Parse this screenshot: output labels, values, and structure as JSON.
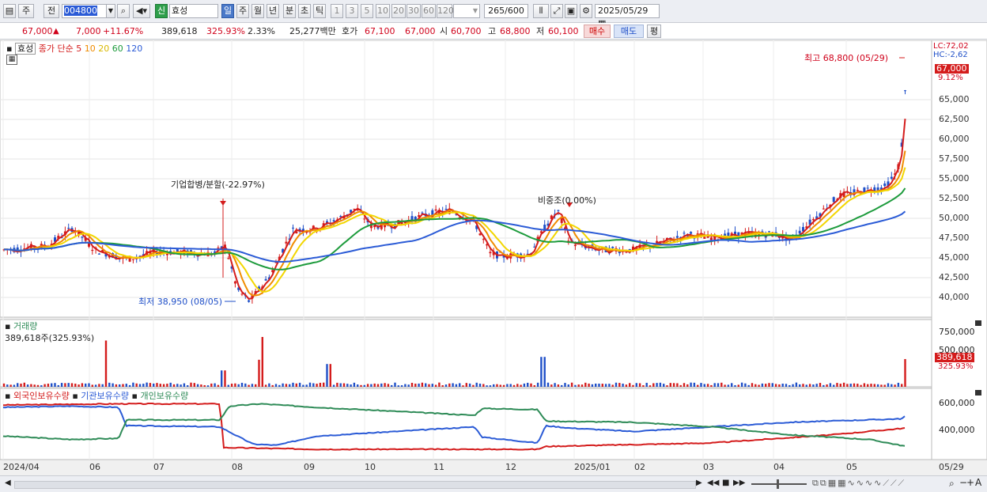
{
  "toolbar": {
    "period": "주",
    "prev": "전",
    "code": "004800",
    "credit": "신",
    "name": "효성",
    "intervals": [
      "일",
      "주",
      "월",
      "년",
      "분",
      "초",
      "틱"
    ],
    "active_interval": "일",
    "minutes": [
      "1",
      "3",
      "5",
      "10",
      "20",
      "30",
      "60",
      "120"
    ],
    "count": "265",
    "count_total": "/600",
    "date": "2025/05/29"
  },
  "quote": {
    "price": "67,000",
    "up_arrow": "▲",
    "change": "7,000",
    "change_pct": "+11.67%",
    "volume": "389,618",
    "volume_ratio": "325.93%",
    "turnover": "2.33%",
    "amount": "25,277백만",
    "ask_label": "호가",
    "ask": "67,100",
    "bid": "67,000",
    "open_label": "시",
    "open": "60,700",
    "high_label": "고",
    "high": "68,800",
    "low_label": "저",
    "low": "60,100",
    "buy": "매수",
    "sell": "매도",
    "eval": "평"
  },
  "legend": {
    "name": "효성",
    "ma_label": "종가 단순",
    "ma_periods": [
      "5",
      "10",
      "20",
      "60",
      "120"
    ],
    "ma_colors": [
      "#d41c1c",
      "#f08c00",
      "#f2d600",
      "#1d9b3c",
      "#2b5bd6"
    ]
  },
  "annotations": {
    "high": "최고 68,800 (05/29)",
    "low": "최저 38,950 (08/05)",
    "merge": "기업합병/분할(-22.97%)",
    "weight": "비중조(0.00%)",
    "lc": "LC:72,02",
    "hc": "HC:-2,62",
    "last_price": "67,000",
    "last_pct": "9.12%"
  },
  "volume_pane": {
    "title": "거래량",
    "value": "389,618주(325.93%)",
    "last": "389,618",
    "last_pct": "325.93%"
  },
  "holdings_pane": {
    "series": [
      "외국인보유수량",
      "기관보유수량",
      "개인보유수량"
    ],
    "colors": [
      "#d41c1c",
      "#2b5bd6",
      "#2e8b57"
    ]
  },
  "axes": {
    "price_ticks": [
      "65,000",
      "62,500",
      "60,000",
      "57,500",
      "55,000",
      "52,500",
      "50,000",
      "47,500",
      "45,000",
      "42,500",
      "40,000"
    ],
    "volume_ticks": [
      "750,000",
      "500,000"
    ],
    "holding_ticks": [
      "600,000",
      "400,000"
    ],
    "x_labels": [
      "2024/04",
      "06",
      "07",
      "08",
      "09",
      "10",
      "11",
      "12",
      "2025/01",
      "02",
      "03",
      "04",
      "05",
      "05/29"
    ]
  },
  "chart_data": {
    "type": "candlestick",
    "x_range": [
      "2024/04",
      "2025/05/29"
    ],
    "ylim": [
      38000,
      72000
    ],
    "high": {
      "value": 68800,
      "date": "05/29"
    },
    "low": {
      "value": 38950,
      "date": "08/05"
    },
    "last": 67000
  }
}
